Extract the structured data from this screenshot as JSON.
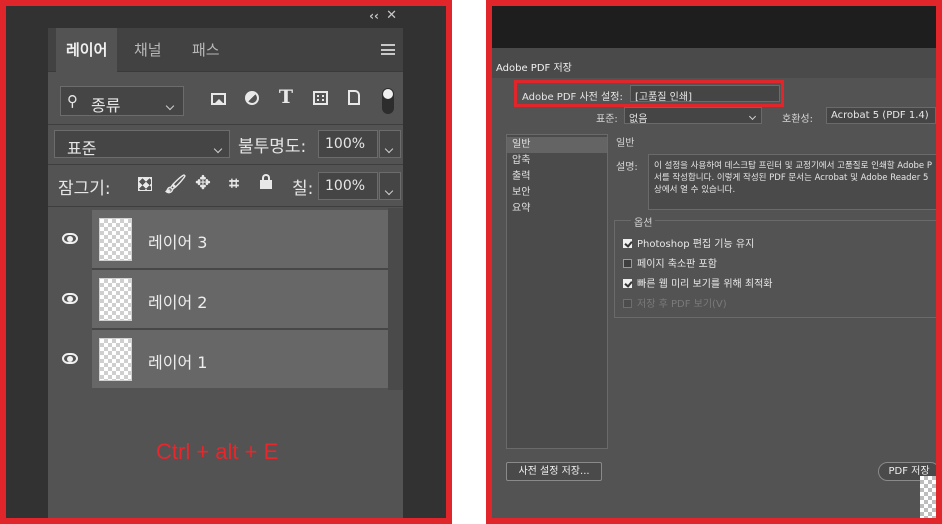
{
  "layers_panel": {
    "tabs": [
      {
        "label": "레이어",
        "active": true
      },
      {
        "label": "채널",
        "active": false
      },
      {
        "label": "패스",
        "active": false
      }
    ],
    "filter": {
      "icon": "search-icon",
      "label": "종류"
    },
    "filter_icons": [
      "image-icon",
      "adjustment-icon",
      "type-icon",
      "shape-icon",
      "smart-object-icon"
    ],
    "blend_mode": "표준",
    "opacity_label": "불투명도:",
    "opacity_value": "100%",
    "lock_label": "잠그기:",
    "lock_icons": [
      "lock-transparent-icon",
      "lock-brush-icon",
      "lock-move-icon",
      "lock-artboard-icon",
      "lock-all-icon"
    ],
    "fill_label": "칠:",
    "fill_value": "100%",
    "layers": [
      {
        "name": "레이어 3"
      },
      {
        "name": "레이어 2"
      },
      {
        "name": "레이어 1"
      }
    ],
    "shortcut_text": "Ctrl + alt + E",
    "colors": {
      "highlight": "#e0262b",
      "shortcut": "#e8262b"
    }
  },
  "pdf_dialog": {
    "title": "Adobe PDF 저장",
    "preset_label": "Adobe PDF 사전 설정:",
    "preset_value": "[고품질 인쇄]",
    "standard_label": "표준:",
    "standard_value": "없음",
    "compat_label": "호환성:",
    "compat_value": "Acrobat 5 (PDF 1.4)",
    "sidebar": [
      {
        "label": "일반",
        "active": true
      },
      {
        "label": "압축",
        "active": false
      },
      {
        "label": "출력",
        "active": false
      },
      {
        "label": "보안",
        "active": false
      },
      {
        "label": "요약",
        "active": false
      }
    ],
    "section_title": "일반",
    "desc_label": "설명:",
    "desc_lines": [
      "이 설정을 사용하여 데스크탑 프린터 및 교정기에서 고품질로 인쇄할 Adobe P",
      "서를 작성합니다. 이렇게 작성된 PDF 문서는 Acrobat 및 Adobe Reader 5",
      "상에서 열 수 있습니다."
    ],
    "options_title": "옵션",
    "options": [
      {
        "label": "Photoshop 편집 기능 유지",
        "checked": true,
        "disabled": false
      },
      {
        "label": "페이지 축소판 포함",
        "checked": false,
        "disabled": false
      },
      {
        "label": "빠른 웹 미리 보기를 위해 최적화",
        "checked": true,
        "disabled": false
      },
      {
        "label": "저장 후 PDF 보기(V)",
        "checked": false,
        "disabled": true
      }
    ],
    "save_preset_button": "사전 설정 저장...",
    "save_pdf_button": "PDF 저장"
  }
}
